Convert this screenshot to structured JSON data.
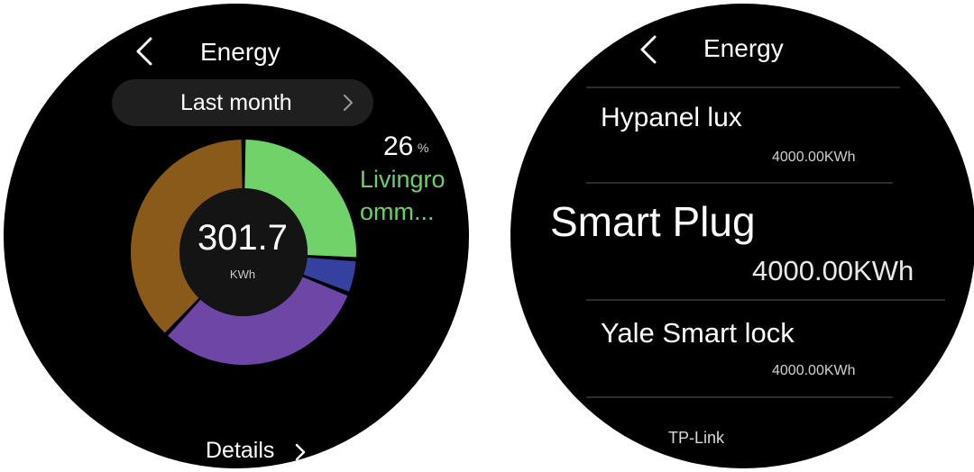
{
  "left_screen": {
    "title": "Energy",
    "icons": {
      "back": "chevron-left-icon",
      "next": "chevron-right-icon"
    },
    "period": {
      "label": "Last  month"
    },
    "total": {
      "value": "301.7",
      "unit": "KWh"
    },
    "highlight": {
      "percent": "26",
      "percent_symbol": "%",
      "name_line1": "Livingro",
      "name_line2": "omm..."
    },
    "details_label": "Details",
    "chart_data": {
      "type": "pie",
      "variant": "donut",
      "center_label": "301.7 KWh",
      "slices": [
        {
          "label": "Livingro omm...",
          "value": 26,
          "color": "#6fd369"
        },
        {
          "label": "",
          "value": 5,
          "color": "#34419e"
        },
        {
          "label": "",
          "value": 31,
          "color": "#6d46a6"
        },
        {
          "label": "",
          "value": 38,
          "color": "#8a5a18"
        }
      ]
    }
  },
  "right_screen": {
    "title": "Energy",
    "devices": [
      {
        "name": "Hypanel lux",
        "value": "4000.00KWh"
      },
      {
        "name": "Smart Plug",
        "value": "4000.00KWh"
      },
      {
        "name": "Yale Smart lock",
        "value": "4000.00KWh"
      },
      {
        "name": "TP-Link"
      }
    ]
  }
}
